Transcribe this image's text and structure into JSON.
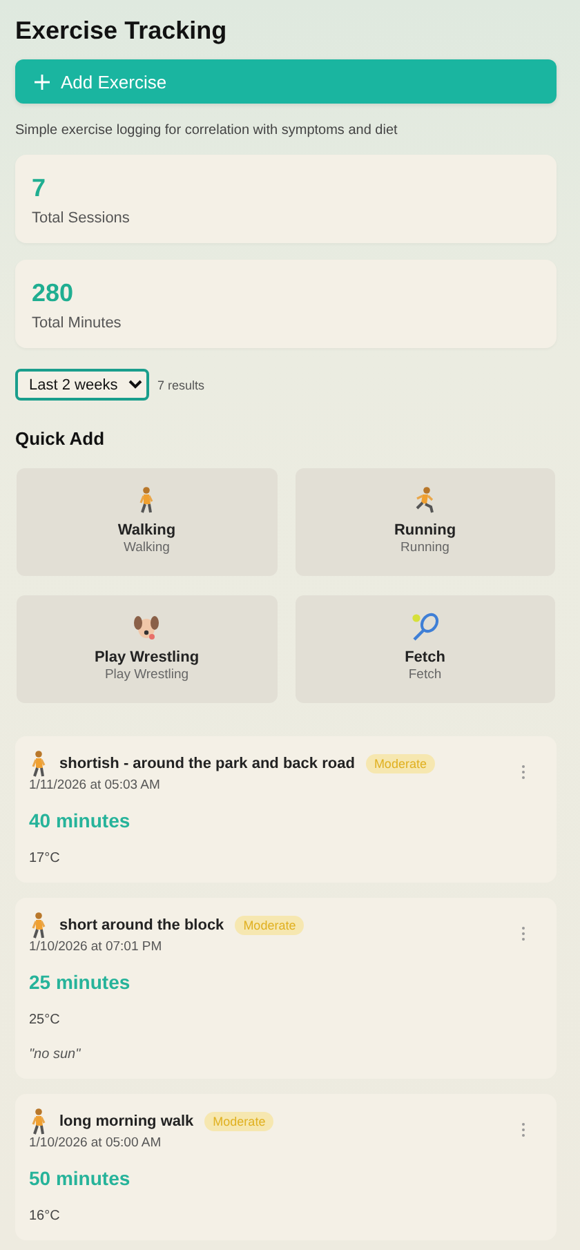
{
  "page": {
    "title": "Exercise Tracking",
    "add_button": "Add Exercise",
    "subtitle": "Simple exercise logging for correlation with symptoms and diet"
  },
  "stats": [
    {
      "value": "7",
      "label": "Total Sessions"
    },
    {
      "value": "280",
      "label": "Total Minutes"
    }
  ],
  "filter": {
    "value": "Last 2 weeks",
    "results": "7 results"
  },
  "quick_add": {
    "heading": "Quick Add",
    "items": [
      {
        "kind": "walk",
        "name": "Walking",
        "category": "Walking"
      },
      {
        "kind": "run",
        "name": "Running",
        "category": "Running"
      },
      {
        "kind": "dog",
        "name": "Play Wrestling",
        "category": "Play Wrestling"
      },
      {
        "kind": "racket",
        "name": "Fetch",
        "category": "Fetch"
      }
    ]
  },
  "sessions": [
    {
      "kind": "walk",
      "title": "shortish - around the park and back road",
      "intensity": "Moderate",
      "datetime": "1/11/2026 at 05:03 AM",
      "duration": "40 minutes",
      "temperature": "17°C"
    },
    {
      "kind": "walk",
      "title": "short around the block",
      "intensity": "Moderate",
      "datetime": "1/10/2026 at 07:01 PM",
      "duration": "25 minutes",
      "temperature": "25°C",
      "note": "\"no sun\""
    },
    {
      "kind": "walk",
      "title": "long morning walk",
      "intensity": "Moderate",
      "datetime": "1/10/2026 at 05:00 AM",
      "duration": "50 minutes",
      "temperature": "16°C"
    }
  ]
}
